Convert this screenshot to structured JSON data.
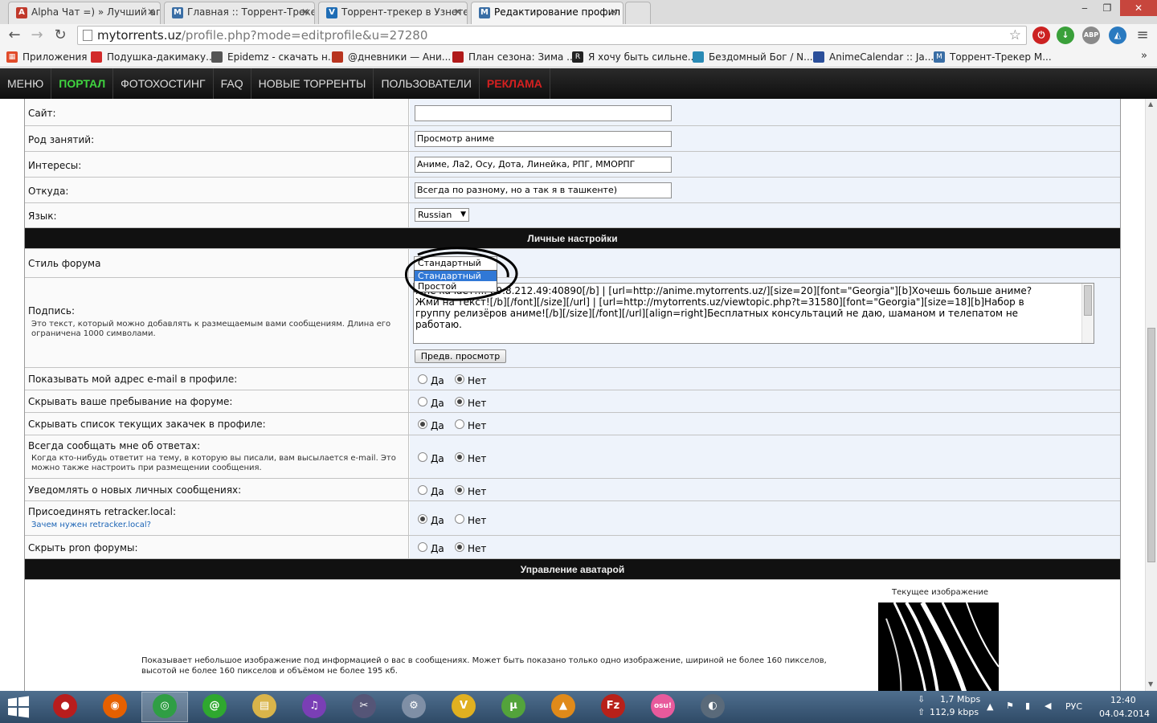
{
  "browser": {
    "tabs": [
      {
        "label": "Alpha Чат =) » Лучший ап",
        "icon_color": "#c0392b",
        "icon_glyph": "A"
      },
      {
        "label": "Главная :: Торрент-Треке",
        "icon_color": "#3a6ea5",
        "icon_glyph": "M"
      },
      {
        "label": "Торрент-трекер в Узнете",
        "icon_color": "#1f6db5",
        "icon_glyph": "V"
      },
      {
        "label": "Редактирование профил",
        "icon_color": "#3a6ea5",
        "icon_glyph": "M"
      }
    ],
    "address_host": "mytorrents.uz",
    "address_path": "/profile.php?mode=editprofile&u=27280",
    "extensions": [
      {
        "name": "adblock-stop-icon",
        "color": "#cc2222",
        "glyph": "⏻"
      },
      {
        "name": "download-arrow-icon",
        "color": "#3aa03a",
        "glyph": "↓"
      },
      {
        "name": "abp-icon",
        "color": "#8a8a8a",
        "glyph": "ABP"
      },
      {
        "name": "tampermonkey-icon",
        "color": "#2a7ac0",
        "glyph": "◭"
      }
    ],
    "bookmarks": [
      {
        "label": "Приложения",
        "icon_color": "#e14b2a"
      },
      {
        "label": "Подушка-дакимаку...",
        "icon_color": "#d22a2a"
      },
      {
        "label": "Epidemz - скачать н...",
        "icon_color": "#555555"
      },
      {
        "label": "@дневники — Ани...",
        "icon_color": "#b8341f"
      },
      {
        "label": "План сезона: Зима ...",
        "icon_color": "#b01a1a"
      },
      {
        "label": "Я хочу быть сильне...",
        "icon_color": "#222222"
      },
      {
        "label": "Бездомный Бог / N...",
        "icon_color": "#2a8ab5"
      },
      {
        "label": "AnimeCalendar :: Ja...",
        "icon_color": "#2b4f9a"
      },
      {
        "label": "Торрент-Трекер M...",
        "icon_color": "#3a6ea5"
      }
    ]
  },
  "site_menu": {
    "items": [
      {
        "label": "Меню",
        "style": "normal"
      },
      {
        "label": "Портал",
        "style": "green"
      },
      {
        "label": "Фотохостинг",
        "style": "normal"
      },
      {
        "label": "FAQ",
        "style": "normal"
      },
      {
        "label": "Новые торренты",
        "style": "normal"
      },
      {
        "label": "Пользователи",
        "style": "normal"
      },
      {
        "label": "Реклама",
        "style": "red"
      }
    ]
  },
  "profile_form": {
    "site": {
      "label": "Сайт:",
      "value": ""
    },
    "occupation": {
      "label": "Род занятий:",
      "value": "Просмотр аниме"
    },
    "interests": {
      "label": "Интересы:",
      "value": "Аниме, Ла2, Осу, Дота, Линейка, РПГ, ММОРПГ"
    },
    "location": {
      "label": "Откуда:",
      "value": "Всегда по разному, но а так я в ташкенте)"
    },
    "language": {
      "label": "Язык:",
      "value": "Russian"
    },
    "personal_settings_title": "Личные настройки",
    "forum_style": {
      "label": "Стиль форума",
      "selected": "Стандартный",
      "options": [
        "Стандартный",
        "Простой"
      ]
    },
    "signature": {
      "label": "Подпись:",
      "hint": "Это текст, который можно добавлять к размещаемым вами сообщениям. Длина его ограничена 1000 символами.",
      "line1": "Мне качает!... 89.8.212.49:40890[/b] | [url=http://anime.mytorrents.uz/][size=20][font=\"Georgia\"][b]Хочешь больше аниме?",
      "line2": "Жми на текст![/b][/font][/size][/url] | [url=http://mytorrents.uz/viewtopic.php?t=31580][font=\"Georgia\"][size=18][b]Набор в",
      "line3": "группу релизёров аниме![/b][/size][/font][/url][align=right]Бесплатных консультаций не даю, шаманом и телепатом не",
      "line4": "работаю.",
      "preview_button": "Предв. просмотр"
    },
    "yes_label": "Да",
    "no_label": "Нет",
    "show_email": {
      "label": "Показывать мой адрес e-mail в профиле:",
      "value": "no"
    },
    "hide_online": {
      "label": "Скрывать ваше пребывание на форуме:",
      "value": "no"
    },
    "hide_downloads": {
      "label": "Скрывать список текущих закачек в профиле:",
      "value": "yes"
    },
    "notify_replies": {
      "label": "Всегда сообщать мне об ответах:",
      "hint": "Когда кто-нибудь ответит на тему, в которую вы писали, вам высылается e-mail. Это можно также настроить при размещении сообщения.",
      "value": "no"
    },
    "notify_pm": {
      "label": "Уведомлять о новых личных сообщениях:",
      "value": "no"
    },
    "retracker": {
      "label": "Присоединять retracker.local:",
      "link": "Зачем нужен retracker.local?",
      "value": "yes"
    },
    "hide_porn": {
      "label": "Скрыть pron форумы:",
      "value": "no"
    },
    "avatar_title": "Управление аватарой",
    "avatar_current": "Текущее изображение",
    "avatar_description": "Показывает небольшое изображение под информацией о вас в сообщениях. Может быть показано только одно изображение, шириной не более 160 пикселов, высотой не более 160 пикселов и объёмом не более 195 кб."
  },
  "taskbar": {
    "apps": [
      {
        "name": "recorder-icon",
        "color": "#b81d1d",
        "glyph": "●"
      },
      {
        "name": "firefox-icon",
        "color": "#e66000",
        "glyph": "◉"
      },
      {
        "name": "chrome-icon",
        "color": "#2f9e44",
        "glyph": "◎"
      },
      {
        "name": "mail-agent-icon",
        "color": "#2fa82f",
        "glyph": "@"
      },
      {
        "name": "file-explorer-icon",
        "color": "#d9b44a",
        "glyph": "▤"
      },
      {
        "name": "audio-app-icon",
        "color": "#7a3fb5",
        "glyph": "♫"
      },
      {
        "name": "video-editor-icon",
        "color": "#555577",
        "glyph": "✂"
      },
      {
        "name": "scanner-icon",
        "color": "#7f8fa6",
        "glyph": "⚙"
      },
      {
        "name": "v-app-icon",
        "color": "#e0b020",
        "glyph": "V"
      },
      {
        "name": "utorrent-icon",
        "color": "#53a33b",
        "glyph": "μ"
      },
      {
        "name": "aimp-icon",
        "color": "#e08a1a",
        "glyph": "▲"
      },
      {
        "name": "filezilla-icon",
        "color": "#b8211a",
        "glyph": "Fz"
      },
      {
        "name": "osu-icon",
        "color": "#e85a9c",
        "glyph": "osu!"
      },
      {
        "name": "speaker-app-icon",
        "color": "#5a6a7a",
        "glyph": "◐"
      }
    ],
    "download_speed": "1,7 Mbps",
    "upload_speed": "112,9 kbps",
    "language": "РУС",
    "time": "12:40",
    "date": "04.04.2014"
  }
}
